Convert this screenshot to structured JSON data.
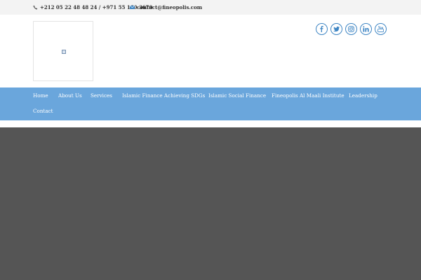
{
  "topbar": {
    "phone": "+212 05 22 48 48 24 / +971 55 160 3670",
    "email": "contact@fineopolis.com",
    "phone_icon": "phone-icon",
    "email_icon": "envelope-icon"
  },
  "logo": {
    "icon": "broken-image-icon"
  },
  "social": [
    "facebook-icon",
    "twitter-icon",
    "instagram-icon",
    "linkedin-icon",
    "youtube-icon"
  ],
  "nav": {
    "items": [
      {
        "label": "Home"
      },
      {
        "label": "About Us"
      },
      {
        "label": "Services"
      },
      {
        "label": "Islamic Finance Achieving SDGs"
      },
      {
        "label": "Islamic Social Finance"
      },
      {
        "label": "Fineopolis Al Maali Institute"
      },
      {
        "label": "Leadership"
      },
      {
        "label": "Contact"
      }
    ]
  },
  "colors": {
    "topbar_bg": "#f3f3f3",
    "nav_bg": "#6aa6dc",
    "accent": "#3f86c4",
    "hero_bg": "#555555"
  }
}
